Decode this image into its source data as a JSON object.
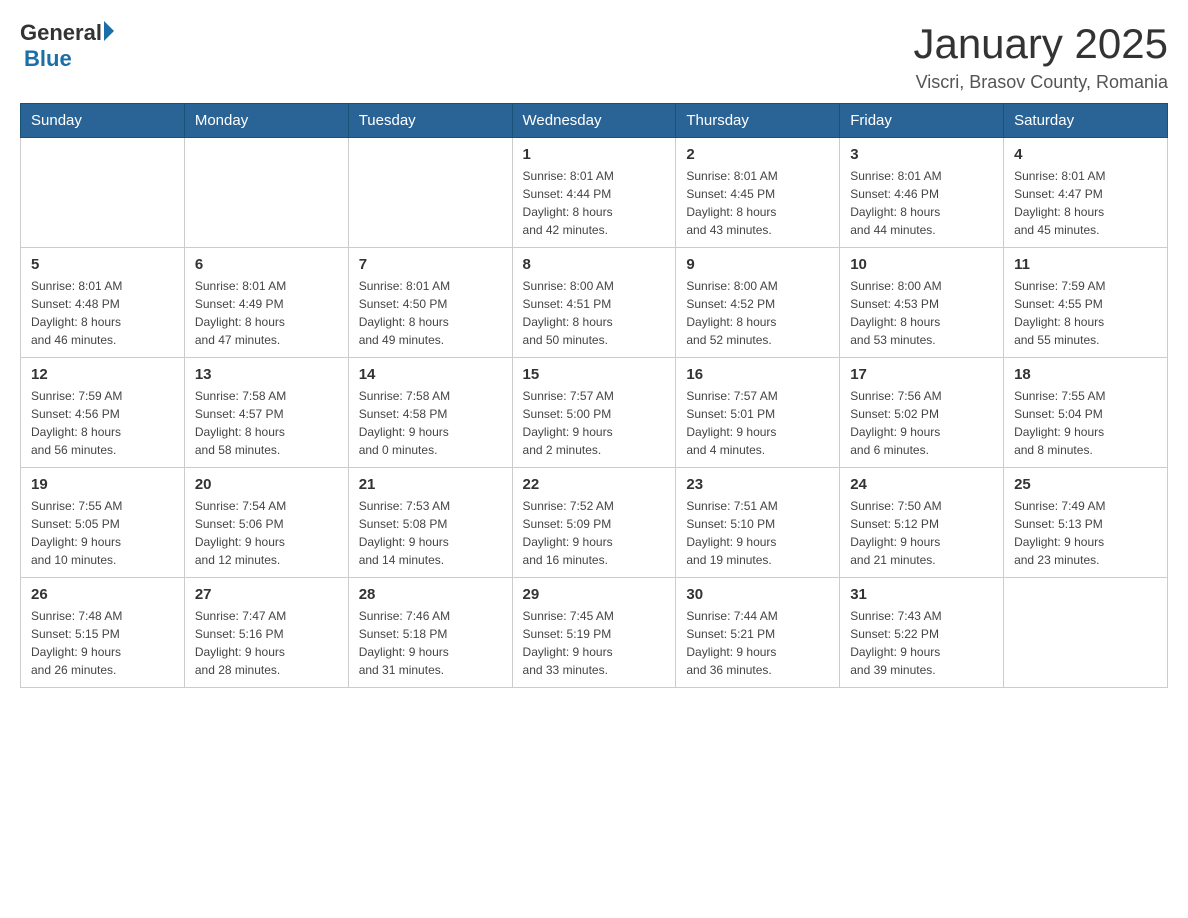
{
  "header": {
    "logo_text_1": "General",
    "logo_text_2": "Blue",
    "title": "January 2025",
    "location": "Viscri, Brasov County, Romania"
  },
  "weekdays": [
    "Sunday",
    "Monday",
    "Tuesday",
    "Wednesday",
    "Thursday",
    "Friday",
    "Saturday"
  ],
  "weeks": [
    [
      {
        "day": "",
        "info": ""
      },
      {
        "day": "",
        "info": ""
      },
      {
        "day": "",
        "info": ""
      },
      {
        "day": "1",
        "info": "Sunrise: 8:01 AM\nSunset: 4:44 PM\nDaylight: 8 hours\nand 42 minutes."
      },
      {
        "day": "2",
        "info": "Sunrise: 8:01 AM\nSunset: 4:45 PM\nDaylight: 8 hours\nand 43 minutes."
      },
      {
        "day": "3",
        "info": "Sunrise: 8:01 AM\nSunset: 4:46 PM\nDaylight: 8 hours\nand 44 minutes."
      },
      {
        "day": "4",
        "info": "Sunrise: 8:01 AM\nSunset: 4:47 PM\nDaylight: 8 hours\nand 45 minutes."
      }
    ],
    [
      {
        "day": "5",
        "info": "Sunrise: 8:01 AM\nSunset: 4:48 PM\nDaylight: 8 hours\nand 46 minutes."
      },
      {
        "day": "6",
        "info": "Sunrise: 8:01 AM\nSunset: 4:49 PM\nDaylight: 8 hours\nand 47 minutes."
      },
      {
        "day": "7",
        "info": "Sunrise: 8:01 AM\nSunset: 4:50 PM\nDaylight: 8 hours\nand 49 minutes."
      },
      {
        "day": "8",
        "info": "Sunrise: 8:00 AM\nSunset: 4:51 PM\nDaylight: 8 hours\nand 50 minutes."
      },
      {
        "day": "9",
        "info": "Sunrise: 8:00 AM\nSunset: 4:52 PM\nDaylight: 8 hours\nand 52 minutes."
      },
      {
        "day": "10",
        "info": "Sunrise: 8:00 AM\nSunset: 4:53 PM\nDaylight: 8 hours\nand 53 minutes."
      },
      {
        "day": "11",
        "info": "Sunrise: 7:59 AM\nSunset: 4:55 PM\nDaylight: 8 hours\nand 55 minutes."
      }
    ],
    [
      {
        "day": "12",
        "info": "Sunrise: 7:59 AM\nSunset: 4:56 PM\nDaylight: 8 hours\nand 56 minutes."
      },
      {
        "day": "13",
        "info": "Sunrise: 7:58 AM\nSunset: 4:57 PM\nDaylight: 8 hours\nand 58 minutes."
      },
      {
        "day": "14",
        "info": "Sunrise: 7:58 AM\nSunset: 4:58 PM\nDaylight: 9 hours\nand 0 minutes."
      },
      {
        "day": "15",
        "info": "Sunrise: 7:57 AM\nSunset: 5:00 PM\nDaylight: 9 hours\nand 2 minutes."
      },
      {
        "day": "16",
        "info": "Sunrise: 7:57 AM\nSunset: 5:01 PM\nDaylight: 9 hours\nand 4 minutes."
      },
      {
        "day": "17",
        "info": "Sunrise: 7:56 AM\nSunset: 5:02 PM\nDaylight: 9 hours\nand 6 minutes."
      },
      {
        "day": "18",
        "info": "Sunrise: 7:55 AM\nSunset: 5:04 PM\nDaylight: 9 hours\nand 8 minutes."
      }
    ],
    [
      {
        "day": "19",
        "info": "Sunrise: 7:55 AM\nSunset: 5:05 PM\nDaylight: 9 hours\nand 10 minutes."
      },
      {
        "day": "20",
        "info": "Sunrise: 7:54 AM\nSunset: 5:06 PM\nDaylight: 9 hours\nand 12 minutes."
      },
      {
        "day": "21",
        "info": "Sunrise: 7:53 AM\nSunset: 5:08 PM\nDaylight: 9 hours\nand 14 minutes."
      },
      {
        "day": "22",
        "info": "Sunrise: 7:52 AM\nSunset: 5:09 PM\nDaylight: 9 hours\nand 16 minutes."
      },
      {
        "day": "23",
        "info": "Sunrise: 7:51 AM\nSunset: 5:10 PM\nDaylight: 9 hours\nand 19 minutes."
      },
      {
        "day": "24",
        "info": "Sunrise: 7:50 AM\nSunset: 5:12 PM\nDaylight: 9 hours\nand 21 minutes."
      },
      {
        "day": "25",
        "info": "Sunrise: 7:49 AM\nSunset: 5:13 PM\nDaylight: 9 hours\nand 23 minutes."
      }
    ],
    [
      {
        "day": "26",
        "info": "Sunrise: 7:48 AM\nSunset: 5:15 PM\nDaylight: 9 hours\nand 26 minutes."
      },
      {
        "day": "27",
        "info": "Sunrise: 7:47 AM\nSunset: 5:16 PM\nDaylight: 9 hours\nand 28 minutes."
      },
      {
        "day": "28",
        "info": "Sunrise: 7:46 AM\nSunset: 5:18 PM\nDaylight: 9 hours\nand 31 minutes."
      },
      {
        "day": "29",
        "info": "Sunrise: 7:45 AM\nSunset: 5:19 PM\nDaylight: 9 hours\nand 33 minutes."
      },
      {
        "day": "30",
        "info": "Sunrise: 7:44 AM\nSunset: 5:21 PM\nDaylight: 9 hours\nand 36 minutes."
      },
      {
        "day": "31",
        "info": "Sunrise: 7:43 AM\nSunset: 5:22 PM\nDaylight: 9 hours\nand 39 minutes."
      },
      {
        "day": "",
        "info": ""
      }
    ]
  ]
}
